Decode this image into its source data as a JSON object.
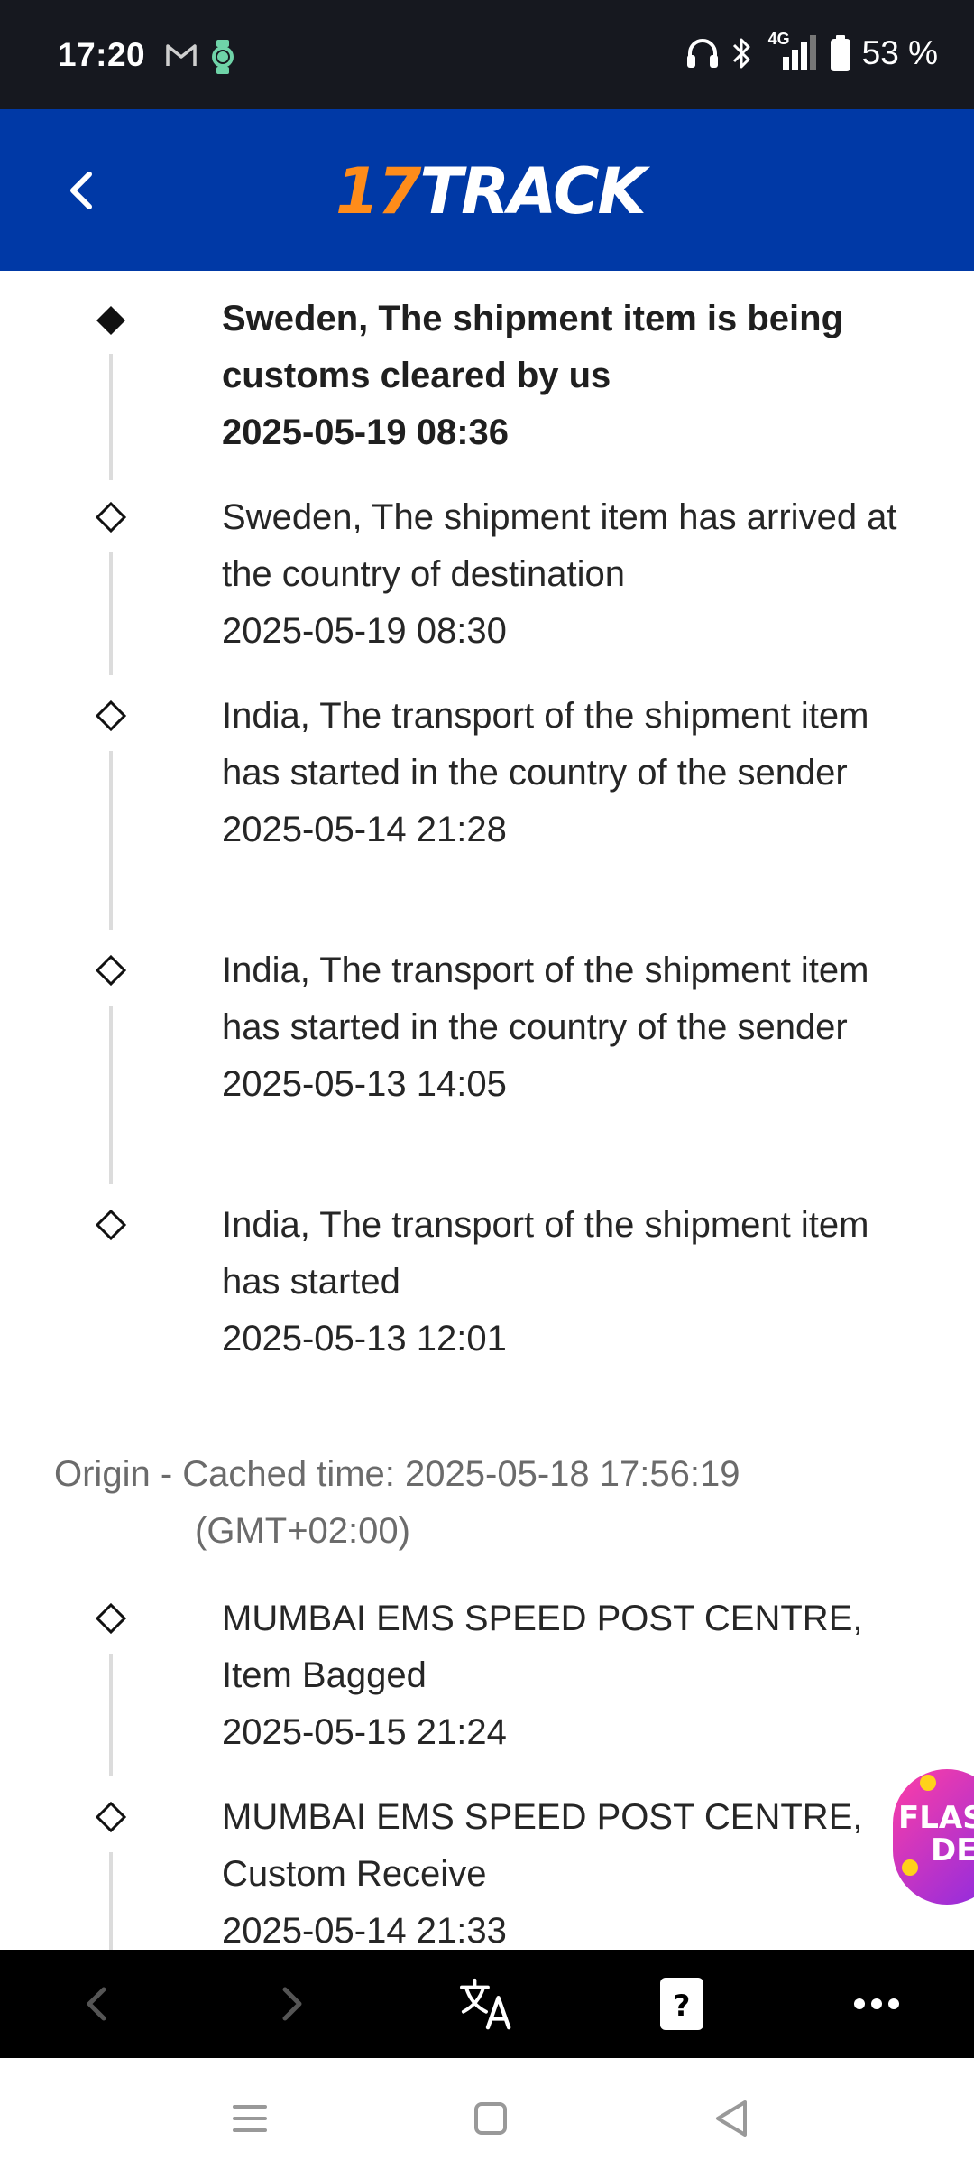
{
  "status_bar": {
    "time": "17:20",
    "network": "4G",
    "battery": "53 %",
    "icons": [
      "gmail-icon",
      "watch-icon",
      "headphones-icon",
      "bluetooth-icon",
      "signal-icon",
      "battery-icon"
    ]
  },
  "header": {
    "logo_num": "17",
    "logo_word": "TRACK",
    "colors": {
      "background": "#0039a6",
      "logo_accent": "#ff8c1a"
    }
  },
  "destination_events": [
    {
      "description": "Sweden, The shipment item is being customs cleared by us",
      "datetime": "2025-05-19 08:36",
      "current": true
    },
    {
      "description": "Sweden, The shipment item has arrived at the country of destination",
      "datetime": "2025-05-19 08:30",
      "current": false
    },
    {
      "description": "India, The transport of the shipment item has started in the country of the sender",
      "datetime": "2025-05-14 21:28",
      "current": false
    },
    {
      "description": "India, The transport of the shipment item has started in the country of the sender",
      "datetime": "2025-05-13 14:05",
      "current": false
    },
    {
      "description": "India, The transport of the shipment item has started",
      "datetime": "2025-05-13 12:01",
      "current": false
    }
  ],
  "origin_section": {
    "label_line1": "Origin - Cached time: 2025-05-18 17:56:19",
    "label_line2": "(GMT+02:00)"
  },
  "origin_events": [
    {
      "description": "MUMBAI EMS SPEED POST CENTRE, Item Bagged",
      "datetime": "2025-05-15 21:24"
    },
    {
      "description": "MUMBAI EMS SPEED POST CENTRE, Custom Receive",
      "datetime": "2025-05-14 21:33"
    }
  ],
  "promo": {
    "text_line1": "FLAS",
    "text_line2": "DE"
  },
  "browser_toolbar": {
    "items": [
      "back-icon",
      "forward-icon",
      "translate-icon",
      "help-card-icon",
      "more-icon"
    ]
  },
  "system_nav": {
    "items": [
      "recents-icon",
      "home-icon",
      "back-icon"
    ]
  }
}
